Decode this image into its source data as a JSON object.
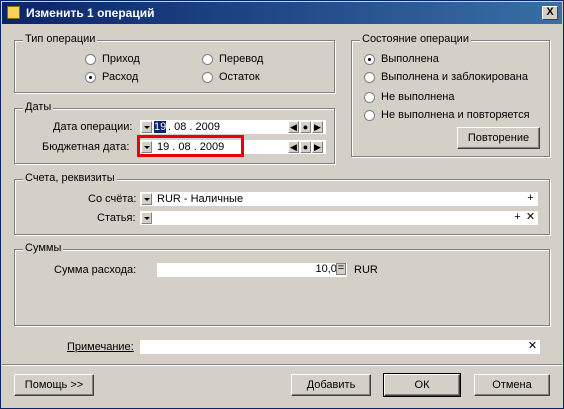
{
  "window": {
    "title": "Изменить 1 операций",
    "close_label": "X"
  },
  "op_type": {
    "title": "Тип операции",
    "options": [
      {
        "label": "Приход",
        "selected": false
      },
      {
        "label": "Перевод",
        "selected": false
      },
      {
        "label": "Расход",
        "selected": true
      },
      {
        "label": "Остаток",
        "selected": false
      }
    ]
  },
  "op_state": {
    "title": "Состояние операции",
    "options": [
      {
        "label": "Выполнена",
        "selected": true
      },
      {
        "label": "Выполнена и заблокирована",
        "selected": false
      },
      {
        "label": "Не выполнена",
        "selected": false
      },
      {
        "label": "Не выполнена и повторяется",
        "selected": false
      }
    ],
    "repeat_button": "Повторение"
  },
  "dates": {
    "title": "Даты",
    "operation_date_label": "Дата операции:",
    "operation_date_day": "19",
    "operation_date_rest": ". 08 . 2009",
    "budget_date_label": "Бюджетная дата:",
    "budget_date_value": "19 . 08 . 2009"
  },
  "accounts": {
    "title": "Счета, реквизиты",
    "from_label": "Со счёта:",
    "from_value": "RUR - Наличные",
    "article_label": "Статья:",
    "article_value": ""
  },
  "sums": {
    "title": "Суммы",
    "expense_label": "Сумма расхода:",
    "expense_value": "10,00",
    "currency": "RUR"
  },
  "note": {
    "label": "Примечание:",
    "value": ""
  },
  "buttons": {
    "help": "Помощь >>",
    "add": "Добавить",
    "ok": "ОК",
    "cancel": "Отмена"
  },
  "highlight_color": "#e8000b"
}
